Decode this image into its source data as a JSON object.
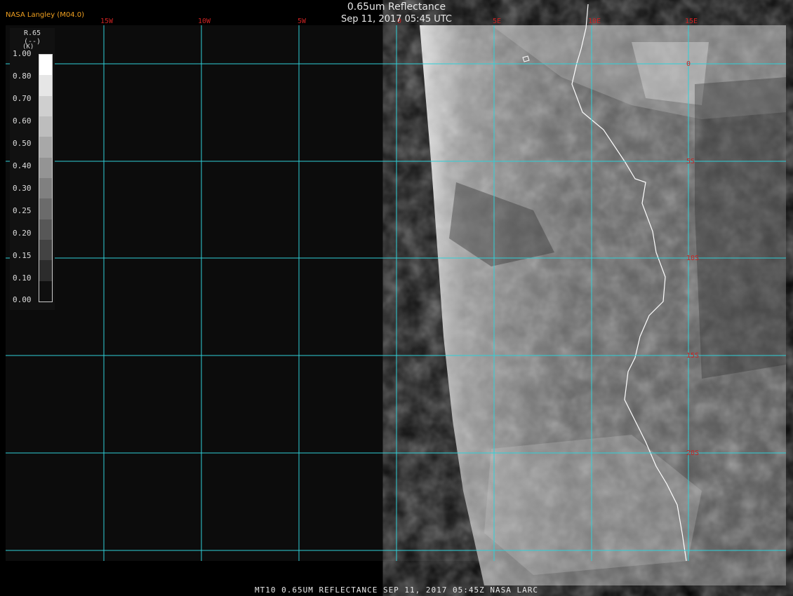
{
  "header": {
    "agency": "NASA Langley (M04.0)",
    "title": "0.65um Reflectance",
    "datetime": "Sep 11, 2017 05:45 UTC"
  },
  "footer": {
    "caption": "MT10  0.65UM REFLECTANCE   SEP 11, 2017 05:45Z   NASA LARC"
  },
  "legend": {
    "title_line1": "R.65",
    "title_line2": "(--)",
    "title_line3": "(K)",
    "values": [
      "1.00",
      "0.80",
      "0.70",
      "0.60",
      "0.50",
      "0.40",
      "0.30",
      "0.25",
      "0.20",
      "0.15",
      "0.10",
      "0.00"
    ],
    "colors": [
      "#ffffff",
      "#e6e6e6",
      "#cfcfcf",
      "#bdbdbd",
      "#a8a8a8",
      "#949494",
      "#808080",
      "#6b6b6b",
      "#575757",
      "#434343",
      "#2c2c2c",
      "#0f0f0f"
    ]
  },
  "grid": {
    "color": "#2fd0d8",
    "longitude_labels": [
      "15W",
      "10W",
      "5W",
      "0",
      "5E",
      "10E",
      "15E"
    ],
    "latitude_labels": [
      "0",
      "5S",
      "10S",
      "15S",
      "20S"
    ]
  },
  "colors": {
    "coastline": "#ffffff",
    "ocean_no_data": "#0c0c0c",
    "labels": "#cc2222",
    "header_label": "#f0a020"
  }
}
